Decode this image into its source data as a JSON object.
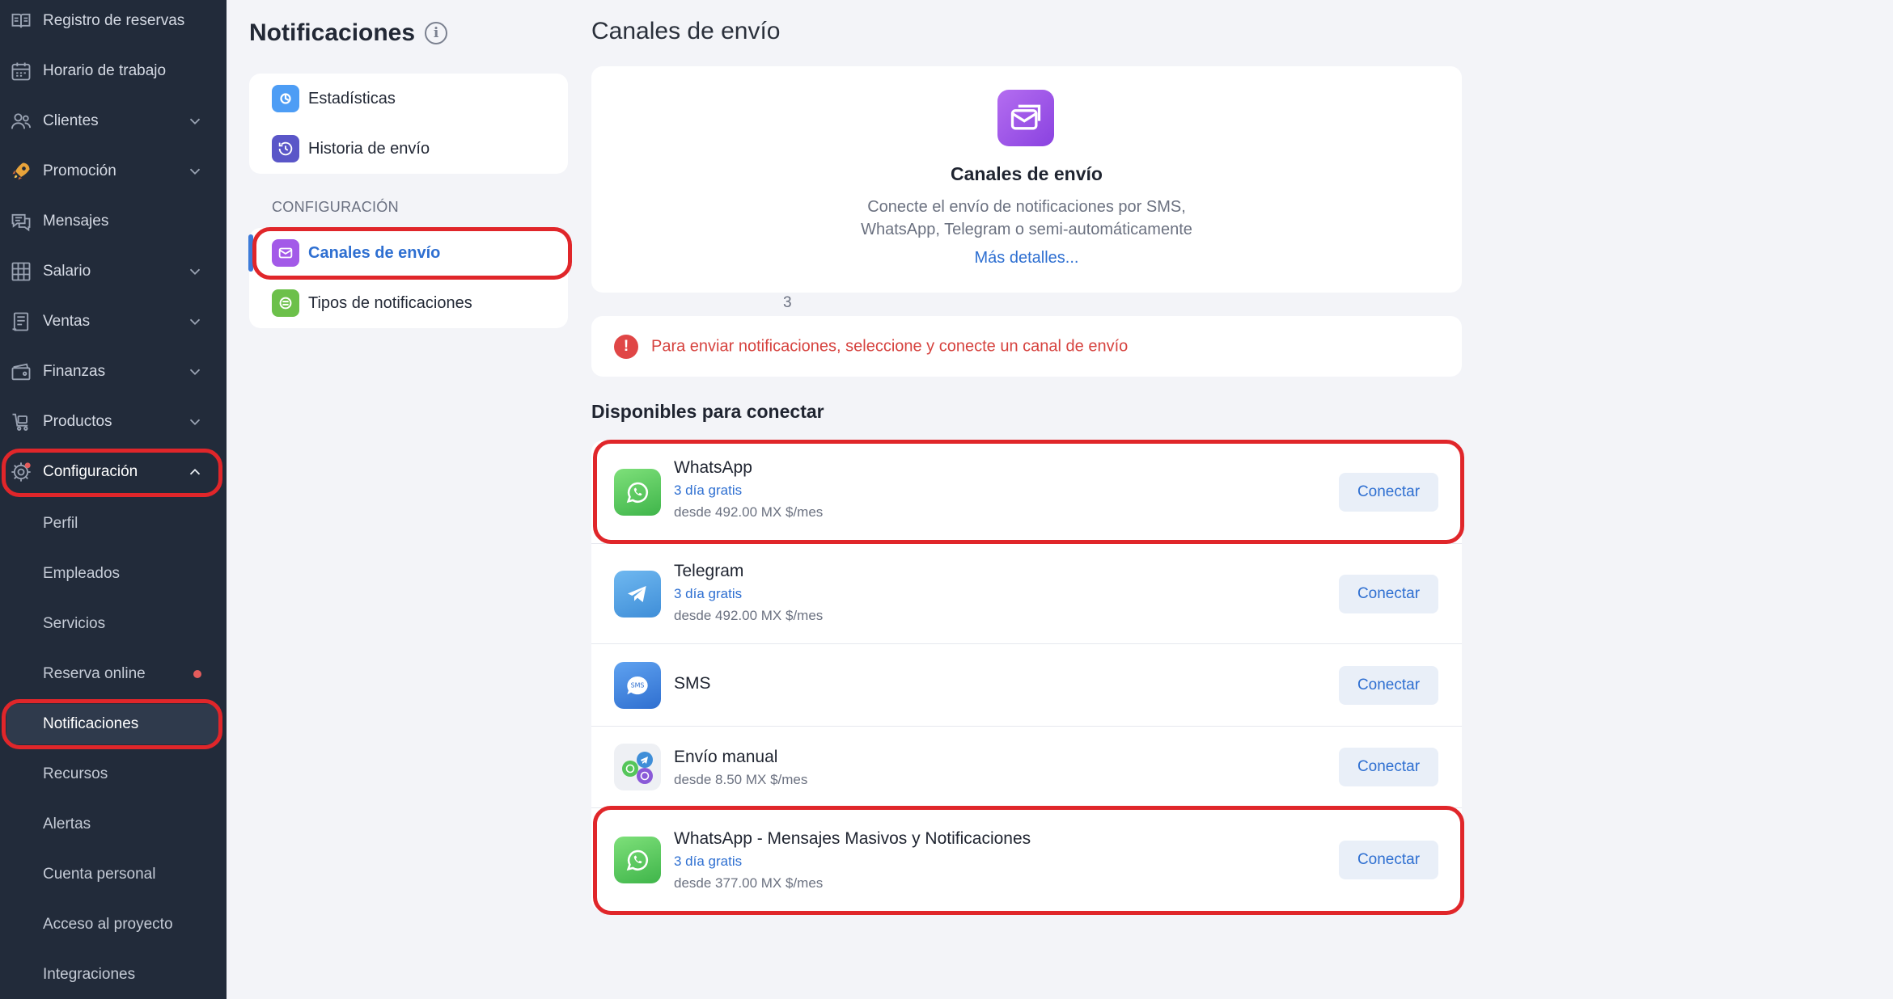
{
  "sidebar": {
    "items": [
      {
        "label": "Registro de reservas",
        "icon": "book-icon",
        "chevron": false
      },
      {
        "label": "Horario de trabajo",
        "icon": "calendar-icon",
        "chevron": false
      },
      {
        "label": "Clientes",
        "icon": "users-icon",
        "chevron": true
      },
      {
        "label": "Promoción",
        "icon": "rocket-icon",
        "chevron": true
      },
      {
        "label": "Mensajes",
        "icon": "chat-icon",
        "chevron": false
      },
      {
        "label": "Salario",
        "icon": "table-icon",
        "chevron": true
      },
      {
        "label": "Ventas",
        "icon": "register-icon",
        "chevron": true
      },
      {
        "label": "Finanzas",
        "icon": "money-icon",
        "chevron": true
      },
      {
        "label": "Productos",
        "icon": "cart-icon",
        "chevron": true
      },
      {
        "label": "Configuración",
        "icon": "gear-icon",
        "chevron": true,
        "expanded": true
      }
    ],
    "sub_items": [
      {
        "label": "Perfil"
      },
      {
        "label": "Empleados"
      },
      {
        "label": "Servicios"
      },
      {
        "label": "Reserva online",
        "dot": true
      },
      {
        "label": "Notificaciones",
        "active": true
      },
      {
        "label": "Recursos"
      },
      {
        "label": "Alertas"
      },
      {
        "label": "Cuenta personal"
      },
      {
        "label": "Acceso al proyecto"
      },
      {
        "label": "Integraciones"
      }
    ]
  },
  "notifications_menu": {
    "title": "Notificaciones",
    "top_items": [
      {
        "label": "Estadísticas"
      },
      {
        "label": "Historia de envío"
      }
    ],
    "section_label": "CONFIGURACIÓN",
    "config_items": [
      {
        "label": "Canales de envío",
        "active": true,
        "alert": "!"
      },
      {
        "label": "Tipos de notificaciones",
        "count": "3"
      }
    ]
  },
  "main": {
    "page_title": "Canales de envío",
    "hero": {
      "title": "Canales de envío",
      "desc_line1": "Conecte el envío de notificaciones por SMS,",
      "desc_line2": "WhatsApp, Telegram o semi-automáticamente",
      "link": "Más detalles..."
    },
    "warning": {
      "icon": "!",
      "text": "Para enviar notificaciones, seleccione y conecte un canal de envío"
    },
    "available_title": "Disponibles para conectar",
    "connect_label": "Conectar",
    "channels": [
      {
        "name": "WhatsApp",
        "trial": "3 día gratis",
        "price": "desde 492.00 MX $/mes",
        "icon": "whatsapp-icon"
      },
      {
        "name": "Telegram",
        "trial": "3 día gratis",
        "price": "desde 492.00 MX $/mes",
        "icon": "telegram-icon"
      },
      {
        "name": "SMS",
        "icon": "sms-icon",
        "badge": "SMS"
      },
      {
        "name": "Envío manual",
        "price": "desde 8.50 MX $/mes",
        "icon": "manual-send-icon"
      },
      {
        "name": "WhatsApp - Mensajes Masivos y Notificaciones",
        "trial": "3 día gratis",
        "price": "desde 377.00 MX $/mes",
        "icon": "whatsapp-icon"
      }
    ]
  },
  "colors": {
    "sidebar_bg": "#222b3a",
    "accent_blue": "#2e6fd1",
    "error_red": "#e04646",
    "highlight_ring": "#e0262a"
  }
}
